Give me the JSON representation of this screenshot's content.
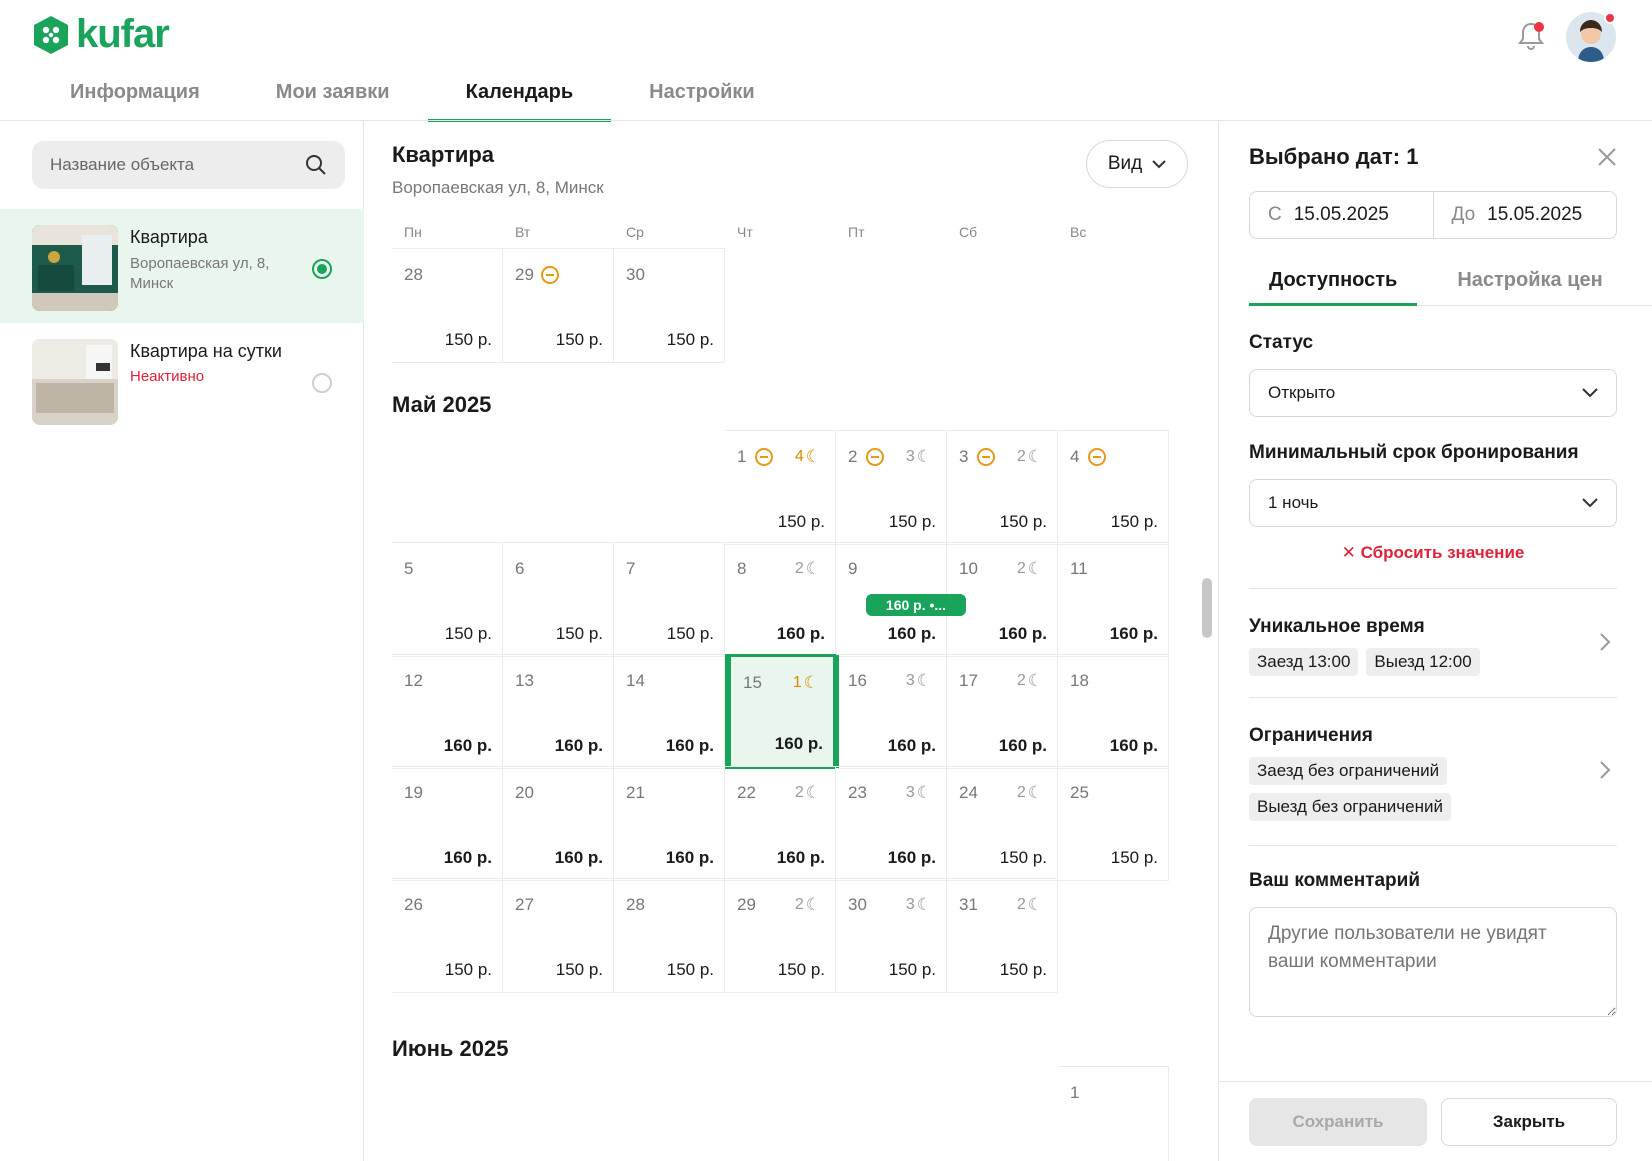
{
  "brand": {
    "name": "kufar",
    "color": "#1aa35a"
  },
  "header": {
    "bell_icon": "bell-icon",
    "has_notification": true
  },
  "tabs": [
    {
      "label": "Информация"
    },
    {
      "label": "Мои заявки"
    },
    {
      "label": "Календарь",
      "active": true
    },
    {
      "label": "Настройки"
    }
  ],
  "sidebar": {
    "search_placeholder": "Название объекта",
    "objects": [
      {
        "name": "Квартира",
        "address": "Воропаевская ул, 8, Минск",
        "selected": true
      },
      {
        "name": "Квартира на сутки",
        "status": "Неактивно",
        "selected": false
      }
    ]
  },
  "calendar": {
    "title": "Квартира",
    "address": "Воропаевская ул, 8, Минск",
    "view_label": "Вид",
    "weekdays": [
      "Пн",
      "Вт",
      "Ср",
      "Чт",
      "Пт",
      "Сб",
      "Вс"
    ],
    "april_tail": [
      {
        "day": "28",
        "price": "150 р."
      },
      {
        "day": "29",
        "price": "150 р.",
        "locked": true
      },
      {
        "day": "30",
        "price": "150 р."
      }
    ],
    "may_title": "Май 2025",
    "may_booking_label": "160 р. •...",
    "may": [
      {
        "day": "1",
        "price": "150 р.",
        "locked": true,
        "nights": "4",
        "nights_color": "orange"
      },
      {
        "day": "2",
        "price": "150 р.",
        "locked": true,
        "nights": "3"
      },
      {
        "day": "3",
        "price": "150 р.",
        "locked": true,
        "nights": "2"
      },
      {
        "day": "4",
        "price": "150 р.",
        "locked": true
      },
      {
        "day": "5",
        "price": "150 р."
      },
      {
        "day": "6",
        "price": "150 р."
      },
      {
        "day": "7",
        "price": "150 р."
      },
      {
        "day": "8",
        "price": "160 р.",
        "bold": true,
        "nights": "2"
      },
      {
        "day": "9",
        "price": "160 р.",
        "bold": true
      },
      {
        "day": "10",
        "price": "160 р.",
        "bold": true,
        "nights": "2"
      },
      {
        "day": "11",
        "price": "160 р.",
        "bold": true
      },
      {
        "day": "12",
        "price": "160 р.",
        "bold": true
      },
      {
        "day": "13",
        "price": "160 р.",
        "bold": true
      },
      {
        "day": "14",
        "price": "160 р.",
        "bold": true
      },
      {
        "day": "15",
        "price": "160 р.",
        "bold": true,
        "nights": "1",
        "nights_color": "orange",
        "selected": true
      },
      {
        "day": "16",
        "price": "160 р.",
        "bold": true,
        "nights": "3"
      },
      {
        "day": "17",
        "price": "160 р.",
        "bold": true,
        "nights": "2"
      },
      {
        "day": "18",
        "price": "160 р.",
        "bold": true
      },
      {
        "day": "19",
        "price": "160 р.",
        "bold": true
      },
      {
        "day": "20",
        "price": "160 р.",
        "bold": true
      },
      {
        "day": "21",
        "price": "160 р.",
        "bold": true
      },
      {
        "day": "22",
        "price": "160 р.",
        "bold": true,
        "nights": "2"
      },
      {
        "day": "23",
        "price": "160 р.",
        "bold": true,
        "nights": "3"
      },
      {
        "day": "24",
        "price": "150 р.",
        "nights": "2"
      },
      {
        "day": "25",
        "price": "150 р."
      },
      {
        "day": "26",
        "price": "150 р."
      },
      {
        "day": "27",
        "price": "150 р."
      },
      {
        "day": "28",
        "price": "150 р."
      },
      {
        "day": "29",
        "price": "150 р.",
        "nights": "2"
      },
      {
        "day": "30",
        "price": "150 р.",
        "nights": "3"
      },
      {
        "day": "31",
        "price": "150 р.",
        "nights": "2"
      }
    ],
    "june_title": "Июнь 2025",
    "june": [
      {
        "day": "1"
      }
    ]
  },
  "panel": {
    "title": "Выбрано дат: 1",
    "from_label": "С",
    "from_value": "15.05.2025",
    "to_label": "До",
    "to_value": "15.05.2025",
    "tabs": [
      "Доступность",
      "Настройка цен"
    ],
    "status_label": "Статус",
    "status_value": "Открыто",
    "min_stay_label": "Минимальный срок бронирования",
    "min_stay_value": "1 ночь",
    "reset_label": "Сбросить значение",
    "unique_time_label": "Уникальное время",
    "checkin_chip": "Заезд 13:00",
    "checkout_chip": "Выезд 12:00",
    "restrictions_label": "Ограничения",
    "restriction_in": "Заезд без ограничений",
    "restriction_out": "Выезд без ограничений",
    "comment_label": "Ваш комментарий",
    "comment_placeholder": "Другие пользователи не увидят ваши комментарии",
    "save_label": "Сохранить",
    "close_label": "Закрыть"
  }
}
